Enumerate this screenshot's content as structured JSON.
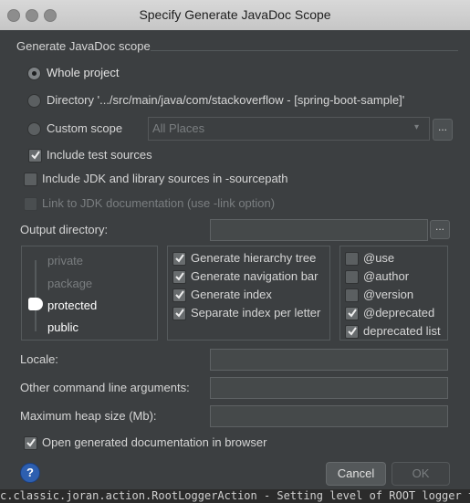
{
  "window": {
    "title": "Specify Generate JavaDoc Scope"
  },
  "scope": {
    "group_label": "Generate JavaDoc scope",
    "whole_project": "Whole project",
    "directory": "Directory '.../src/main/java/com/stackoverflow - [spring-boot-sample]'",
    "custom_scope": "Custom scope",
    "custom_scope_value": "All Places",
    "include_test_sources": "Include test sources",
    "selected": "Whole project",
    "include_test_sources_checked": true
  },
  "options": {
    "include_jdk": "Include JDK and library sources in -sourcepath",
    "include_jdk_checked": false,
    "link_jdk": "Link to JDK documentation (use -link option)",
    "link_jdk_checked": false
  },
  "output": {
    "label": "Output directory:",
    "value": ""
  },
  "visibility": {
    "levels": [
      "private",
      "package",
      "protected",
      "public"
    ],
    "selected": "protected"
  },
  "generate": {
    "items": [
      {
        "label": "Generate hierarchy tree",
        "checked": true
      },
      {
        "label": "Generate navigation bar",
        "checked": true
      },
      {
        "label": "Generate index",
        "checked": true
      },
      {
        "label": "Separate index per letter",
        "checked": true
      }
    ]
  },
  "tags": {
    "items": [
      {
        "label": "@use",
        "checked": false
      },
      {
        "label": "@author",
        "checked": false
      },
      {
        "label": "@version",
        "checked": false
      },
      {
        "label": "@deprecated",
        "checked": true
      },
      {
        "label": "deprecated list",
        "checked": true
      }
    ]
  },
  "locale": {
    "label": "Locale:",
    "value": ""
  },
  "other_args": {
    "label": "Other command line arguments:",
    "value": ""
  },
  "heap": {
    "label": "Maximum heap size (Mb):",
    "value": ""
  },
  "open_browser": {
    "label": "Open generated documentation in browser",
    "checked": true
  },
  "buttons": {
    "cancel": "Cancel",
    "ok": "OK",
    "browse": "..."
  },
  "terminal": {
    "text": "c.classic.joran.action.RootLoggerAction - Setting level of ROOT logger to"
  },
  "colors": {
    "accent": "#2d5fb0",
    "background": "#3c3f41"
  }
}
